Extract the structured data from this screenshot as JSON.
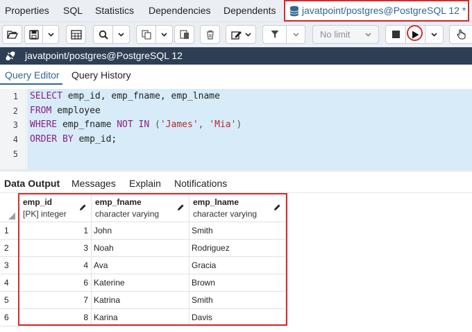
{
  "top_tabs": [
    {
      "label": "Properties"
    },
    {
      "label": "SQL"
    },
    {
      "label": "Statistics"
    },
    {
      "label": "Dependencies"
    },
    {
      "label": "Dependents"
    },
    {
      "label": "javatpoint/postgres@PostgreSQL 12 *",
      "icon": "database-icon"
    }
  ],
  "toolbar": {
    "limit_label": "No limit"
  },
  "connection": {
    "label": "javatpoint/postgres@PostgreSQL 12"
  },
  "editor_tabs": [
    {
      "label": "Query Editor"
    },
    {
      "label": "Query History"
    }
  ],
  "line_numbers": [
    "1",
    "2",
    "3",
    "4",
    "5"
  ],
  "sql": {
    "line1": {
      "kw": "SELECT",
      "rest": " emp_id, emp_fname, emp_lname"
    },
    "line2": {
      "kw": "FROM",
      "rest": " employee"
    },
    "line3": {
      "kw1": "WHERE",
      "mid1": " emp_fname ",
      "kw2": "NOT IN",
      "mid2": " (",
      "s1": "'James'",
      "mid3": ", ",
      "s2": "'Mia'",
      "end": ")"
    },
    "line4": {
      "kw": "ORDER BY",
      "rest": " emp_id;"
    }
  },
  "output_tabs": [
    {
      "label": "Data Output"
    },
    {
      "label": "Messages"
    },
    {
      "label": "Explain"
    },
    {
      "label": "Notifications"
    }
  ],
  "grid": {
    "columns": [
      {
        "name": "emp_id",
        "type": "[PK] integer"
      },
      {
        "name": "emp_fname",
        "type": "character varying"
      },
      {
        "name": "emp_lname",
        "type": "character varying"
      }
    ],
    "rows": [
      {
        "n": "1",
        "emp_id": "1",
        "emp_fname": "John",
        "emp_lname": "Smith"
      },
      {
        "n": "2",
        "emp_id": "3",
        "emp_fname": "Noah",
        "emp_lname": "Rodriguez"
      },
      {
        "n": "3",
        "emp_id": "4",
        "emp_fname": "Ava",
        "emp_lname": "Gracia"
      },
      {
        "n": "4",
        "emp_id": "6",
        "emp_fname": "Katerine",
        "emp_lname": "Brown"
      },
      {
        "n": "5",
        "emp_id": "7",
        "emp_fname": "Katrina",
        "emp_lname": "Smith"
      },
      {
        "n": "6",
        "emp_id": "8",
        "emp_fname": "Karina",
        "emp_lname": "Davis"
      }
    ]
  },
  "colors": {
    "accent": "#326690",
    "highlight_box": "#d92a2a",
    "editor_selection": "#d7ecf8",
    "connection_bar": "#2e3f55",
    "keyword": "#8c1d86",
    "string": "#b5282e"
  }
}
